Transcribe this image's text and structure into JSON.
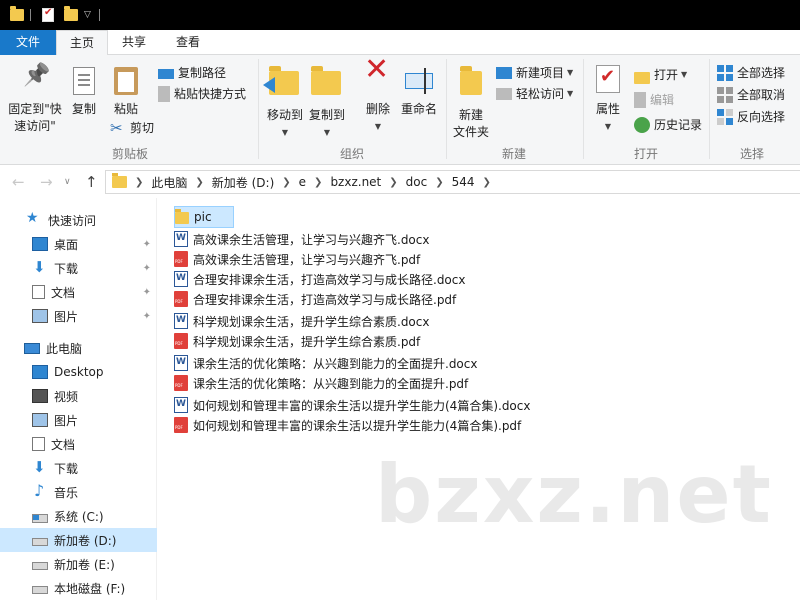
{
  "ribbon_tabs": [
    "文件",
    "主页",
    "共享",
    "查看"
  ],
  "clipboard": {
    "pin_label_1": "固定到\"快",
    "pin_label_2": "速访问\"",
    "copy": "复制",
    "paste": "粘贴",
    "copy_path": "复制路径",
    "paste_shortcut": "粘贴快捷方式",
    "cut": "剪切",
    "group": "剪贴板"
  },
  "organize": {
    "move_to": "移动到",
    "copy_to": "复制到",
    "delete": "删除",
    "rename": "重命名",
    "group": "组织"
  },
  "new": {
    "new_folder_1": "新建",
    "new_folder_2": "文件夹",
    "new_item": "新建项目",
    "easy_access": "轻松访问",
    "group": "新建"
  },
  "open": {
    "properties": "属性",
    "open": "打开",
    "edit": "编辑",
    "history": "历史记录",
    "group": "打开"
  },
  "select": {
    "select_all": "全部选择",
    "select_none": "全部取消",
    "invert": "反向选择",
    "group": "选择"
  },
  "breadcrumb": [
    "此电脑",
    "新加卷 (D:)",
    "e",
    "bzxz.net",
    "doc",
    "544"
  ],
  "nav": {
    "quick_access": "快速访问",
    "desktop_cn": "桌面",
    "downloads_cn": "下载",
    "documents_cn": "文档",
    "pictures_cn": "图片",
    "this_pc": "此电脑",
    "desktop": "Desktop",
    "videos": "视频",
    "pictures": "图片",
    "documents": "文档",
    "downloads": "下载",
    "music": "音乐",
    "drive_c": "系统 (C:)",
    "drive_d": "新加卷 (D:)",
    "drive_e": "新加卷 (E:)",
    "drive_f": "本地磁盘 (F:)"
  },
  "files": [
    {
      "name": "pic",
      "type": "folder"
    },
    {
      "name": "高效课余生活管理，让学习与兴趣齐飞.docx",
      "type": "docx"
    },
    {
      "name": "高效课余生活管理，让学习与兴趣齐飞.pdf",
      "type": "pdf"
    },
    {
      "name": "合理安排课余生活，打造高效学习与成长路径.docx",
      "type": "docx"
    },
    {
      "name": "合理安排课余生活，打造高效学习与成长路径.pdf",
      "type": "pdf"
    },
    {
      "name": "科学规划课余生活，提升学生综合素质.docx",
      "type": "docx"
    },
    {
      "name": "科学规划课余生活，提升学生综合素质.pdf",
      "type": "pdf"
    },
    {
      "name": "课余生活的优化策略：从兴趣到能力的全面提升.docx",
      "type": "docx"
    },
    {
      "name": "课余生活的优化策略：从兴趣到能力的全面提升.pdf",
      "type": "pdf"
    },
    {
      "name": "如何规划和管理丰富的课余生活以提升学生能力(4篇合集).docx",
      "type": "docx"
    },
    {
      "name": "如何规划和管理丰富的课余生活以提升学生能力(4篇合集).pdf",
      "type": "pdf"
    }
  ],
  "watermark": "bzxz.net",
  "colors": {
    "accent": "#1979ca",
    "selection": "#cce8ff",
    "folder": "#f3c94f",
    "pdf": "#e0403a"
  }
}
